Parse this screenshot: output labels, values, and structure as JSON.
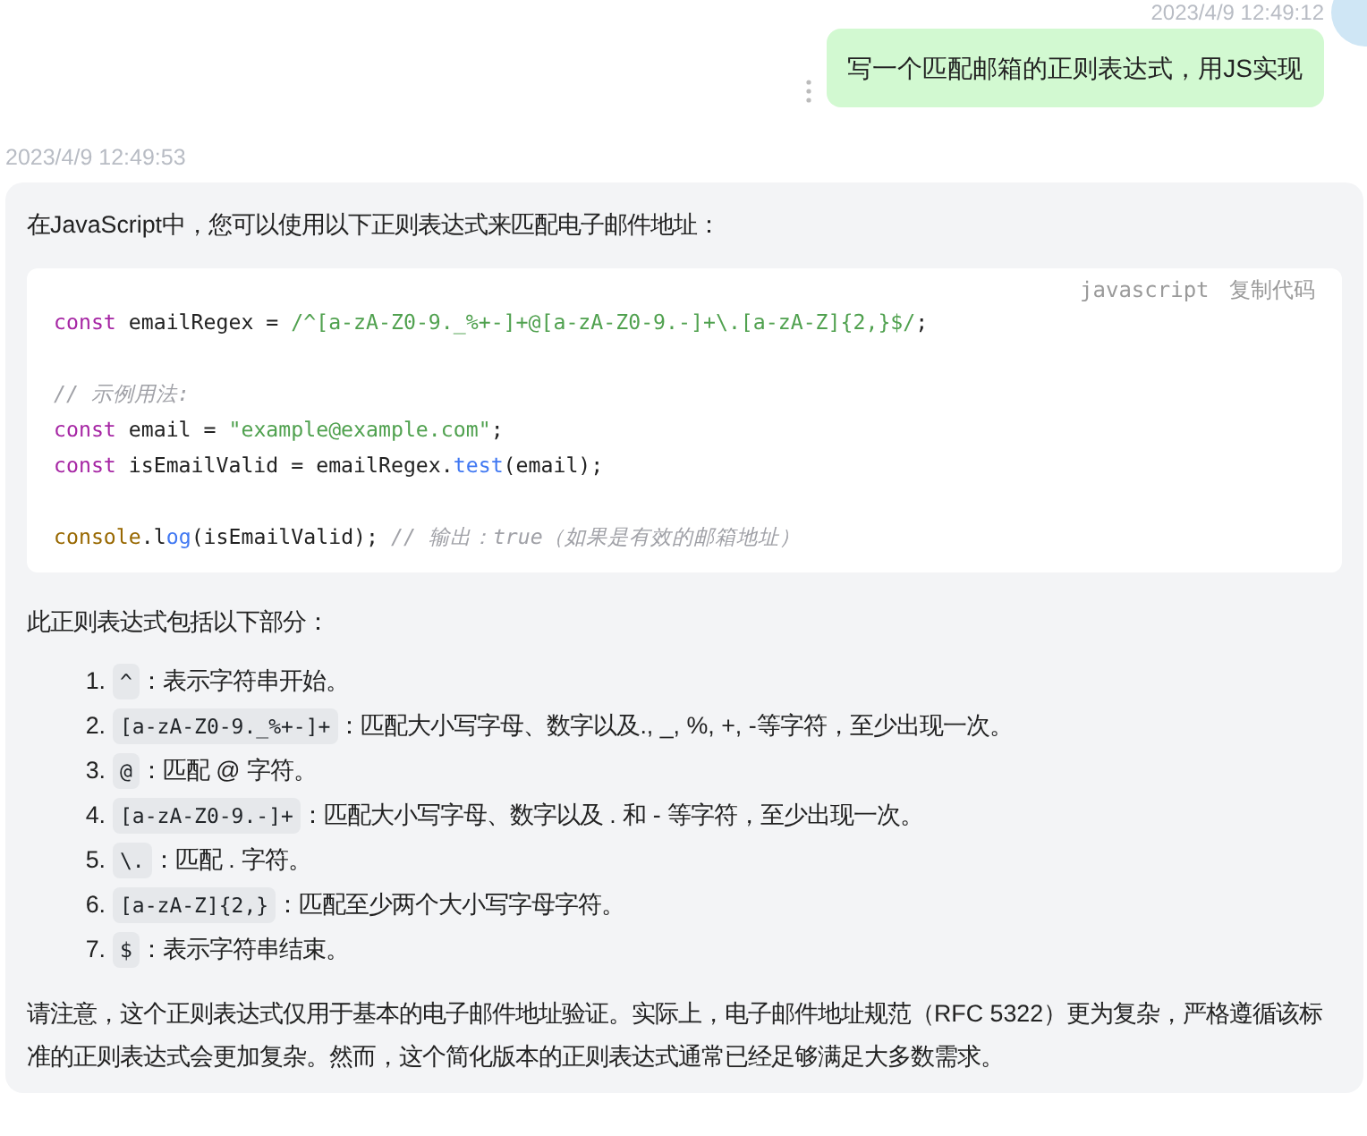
{
  "user_message": {
    "time": "2023/4/9 12:49:12",
    "text": "写一个匹配邮箱的正则表达式，用JS实现"
  },
  "bot_message": {
    "time": "2023/4/9 12:49:53",
    "intro": "在JavaScript中，您可以使用以下正则表达式来匹配电子邮件地址：",
    "code_block": {
      "language": "javascript",
      "copy_label": "复制代码",
      "line_groups": [
        [
          [
            {
              "kind": "keyword",
              "text": "const"
            },
            {
              "kind": "plain",
              "text": " emailRegex = "
            },
            {
              "kind": "string",
              "text": "/^[a-zA-Z0-9._%+-]+@[a-zA-Z0-9.-]+\\.[a-zA-Z]{2,}$/"
            },
            {
              "kind": "plain",
              "text": ";"
            }
          ]
        ],
        [
          [
            {
              "kind": "comment",
              "text": "// 示例用法:"
            }
          ],
          [
            {
              "kind": "keyword",
              "text": "const"
            },
            {
              "kind": "plain",
              "text": " email = "
            },
            {
              "kind": "string",
              "text": "\"example@example.com\""
            },
            {
              "kind": "plain",
              "text": ";"
            }
          ],
          [
            {
              "kind": "keyword",
              "text": "const"
            },
            {
              "kind": "plain",
              "text": " isEmailValid = emailRegex."
            },
            {
              "kind": "function",
              "text": "test"
            },
            {
              "kind": "plain",
              "text": "(email);"
            }
          ]
        ],
        [
          [
            {
              "kind": "object",
              "text": "console"
            },
            {
              "kind": "method",
              "text": ".log"
            },
            {
              "kind": "plain",
              "text": "(isEmailValid); "
            },
            {
              "kind": "comment",
              "text": "// 输出：true（如果是有效的邮箱地址）"
            }
          ]
        ]
      ]
    },
    "list_intro": "此正则表达式包括以下部分：",
    "parts": [
      {
        "number": "1.",
        "code": "^",
        "text": "：表示字符串开始。"
      },
      {
        "number": "2.",
        "code": "[a-zA-Z0-9._%+-]+",
        "text": "：匹配大小写字母、数字以及., _, %, +, -等字符，至少出现一次。"
      },
      {
        "number": "3.",
        "code": "@",
        "text": "：匹配 @ 字符。"
      },
      {
        "number": "4.",
        "code": "[a-zA-Z0-9.-]+",
        "text": "：匹配大小写字母、数字以及 . 和 - 等字符，至少出现一次。"
      },
      {
        "number": "5.",
        "code": "\\.",
        "text": "：匹配 . 字符。"
      },
      {
        "number": "6.",
        "code": "[a-zA-Z]{2,}",
        "text": "：匹配至少两个大小写字母字符。"
      },
      {
        "number": "7.",
        "code": "$",
        "text": "：表示字符串结束。"
      }
    ],
    "note": "请注意，这个正则表达式仅用于基本的电子邮件地址验证。实际上，电子邮件地址规范（RFC 5322）更为复杂，严格遵循该标准的正则表达式会更加复杂。然而，这个简化版本的正则表达式通常已经足够满足大多数需求。"
  }
}
